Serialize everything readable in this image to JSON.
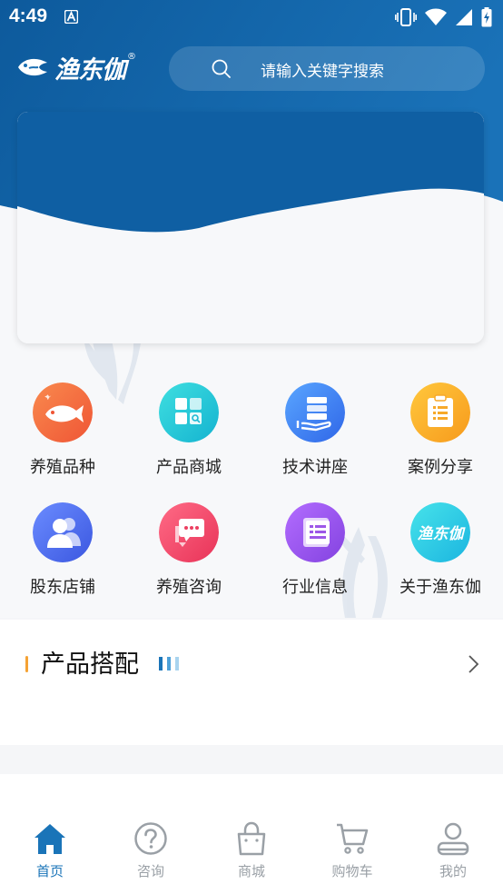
{
  "status_bar": {
    "time": "4:49"
  },
  "header": {
    "logo_text": "渔东伽",
    "logo_mark": "®",
    "search_placeholder": "请输入关键字搜索"
  },
  "menu": [
    {
      "label": "养殖品种",
      "icon": "fish-icon",
      "color": "#f36a43"
    },
    {
      "label": "产品商城",
      "icon": "grid-search-icon",
      "color": "#25c4d6"
    },
    {
      "label": "技术讲座",
      "icon": "server-hand-icon",
      "color": "#3d7ff0"
    },
    {
      "label": "案例分享",
      "icon": "clipboard-icon",
      "color": "#f7a92a"
    },
    {
      "label": "股东店铺",
      "icon": "users-icon",
      "color": "#4d6ef0"
    },
    {
      "label": "养殖咨询",
      "icon": "chat-icon",
      "color": "#f24d6c"
    },
    {
      "label": "行业信息",
      "icon": "news-icon",
      "color": "#9d58e8"
    },
    {
      "label": "关于渔东伽",
      "icon": "brand-logo-icon",
      "color": "#2ac8e4"
    }
  ],
  "section": {
    "title": "产品搭配",
    "accent": "#f5a234"
  },
  "tabbar": {
    "active_color": "#1a74b8",
    "inactive_color": "#9aa0a6",
    "items": [
      {
        "label": "首页",
        "icon": "home-icon",
        "active": true
      },
      {
        "label": "咨询",
        "icon": "question-circle-icon",
        "active": false
      },
      {
        "label": "商城",
        "icon": "shopping-bag-icon",
        "active": false
      },
      {
        "label": "购物车",
        "icon": "cart-icon",
        "active": false
      },
      {
        "label": "我的",
        "icon": "user-icon",
        "active": false
      }
    ]
  },
  "theme": {
    "primary": "#0e5fa3",
    "primary_light": "#1f79c0"
  }
}
